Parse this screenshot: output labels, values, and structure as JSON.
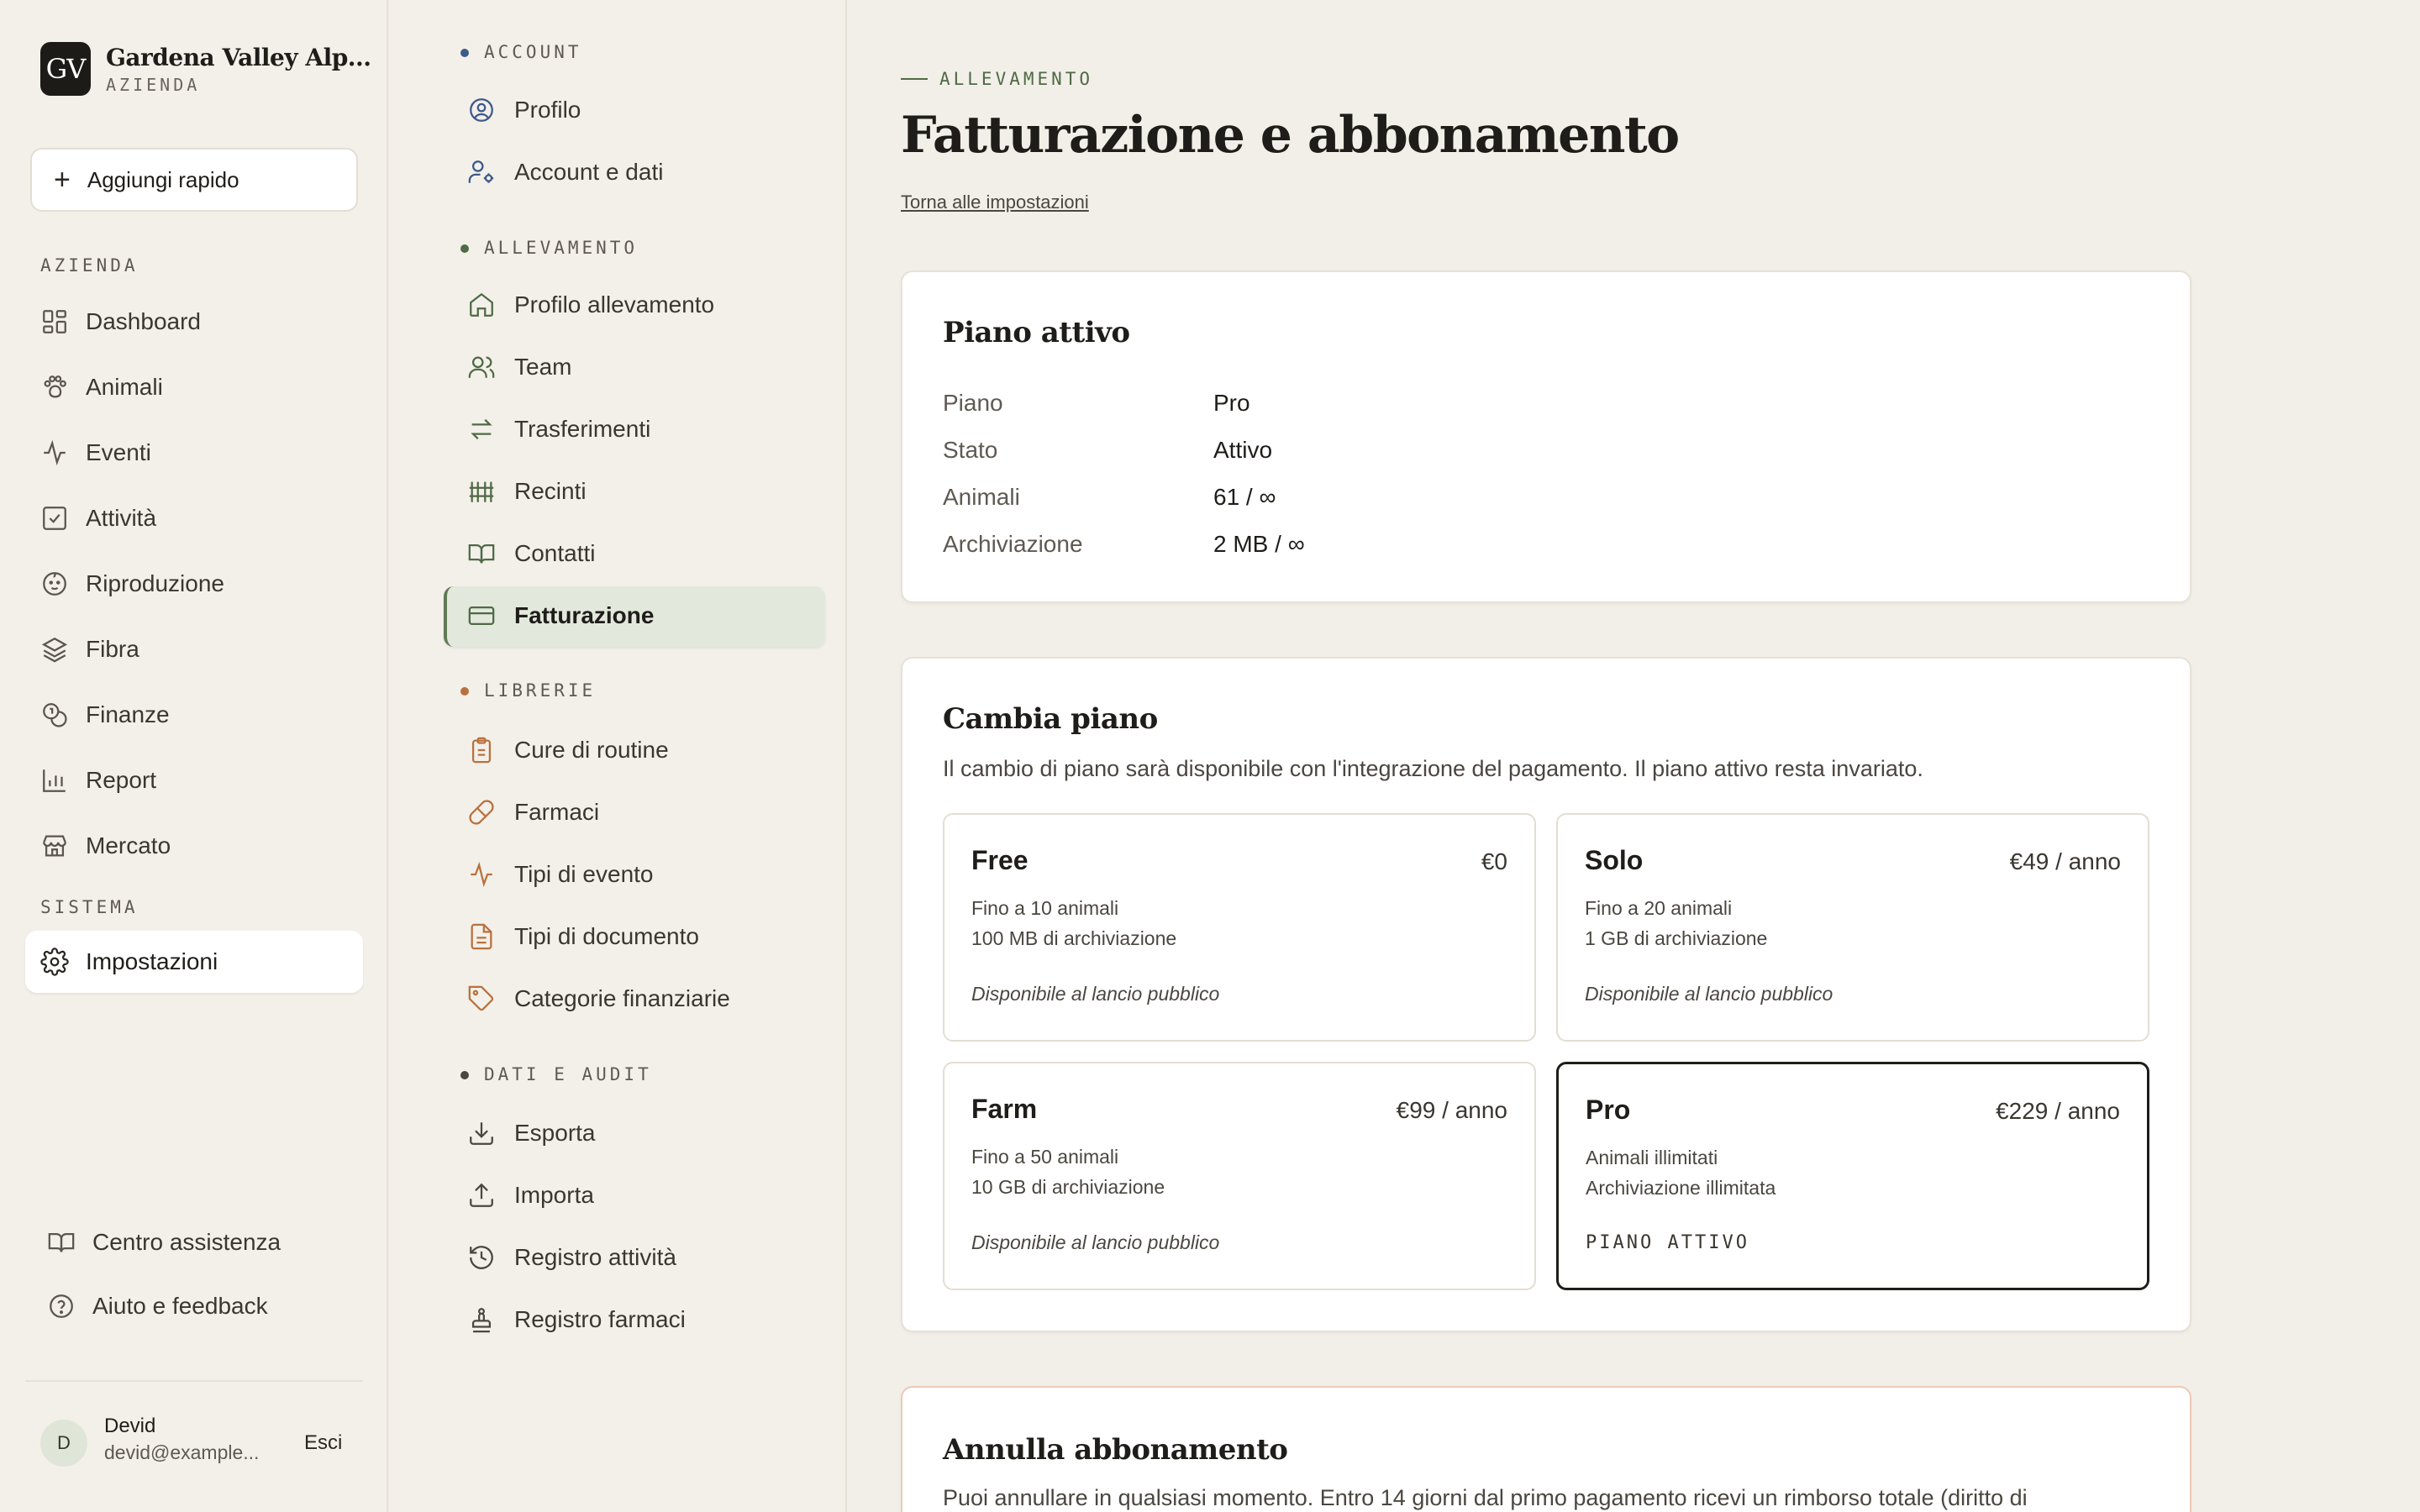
{
  "brand": {
    "initials": "GV",
    "name": "Gardena Valley Alp...",
    "subtitle": "AZIENDA"
  },
  "quick_add": {
    "label": "Aggiungi rapido"
  },
  "sidebar": {
    "section_azienda": "AZIENDA",
    "items": [
      {
        "label": "Dashboard",
        "icon": "grid-icon"
      },
      {
        "label": "Animali",
        "icon": "paw-icon"
      },
      {
        "label": "Eventi",
        "icon": "pulse-icon"
      },
      {
        "label": "Attività",
        "icon": "checkbox-icon"
      },
      {
        "label": "Riproduzione",
        "icon": "baby-icon"
      },
      {
        "label": "Fibra",
        "icon": "layers-icon"
      },
      {
        "label": "Finanze",
        "icon": "coins-icon"
      },
      {
        "label": "Report",
        "icon": "bar-chart-icon"
      },
      {
        "label": "Mercato",
        "icon": "store-icon"
      }
    ],
    "section_sistema": "SISTEMA",
    "settings": {
      "label": "Impostazioni",
      "icon": "gear-icon"
    },
    "help_center": "Centro assistenza",
    "help_feedback": "Aiuto e feedback",
    "user": {
      "initial": "D",
      "name": "Devid",
      "email": "devid@example...",
      "logout": "Esci"
    }
  },
  "subnav": {
    "sections": [
      {
        "title": "ACCOUNT",
        "dot_color": "#3e5a8a",
        "items": [
          {
            "label": "Profilo",
            "icon": "user-circle-icon"
          },
          {
            "label": "Account e dati",
            "icon": "user-cog-icon"
          }
        ]
      },
      {
        "title": "ALLEVAMENTO",
        "dot_color": "#4f6a46",
        "items": [
          {
            "label": "Profilo allevamento",
            "icon": "home-icon"
          },
          {
            "label": "Team",
            "icon": "users-icon"
          },
          {
            "label": "Trasferimenti",
            "icon": "arrows-icon"
          },
          {
            "label": "Recinti",
            "icon": "fence-icon"
          },
          {
            "label": "Contatti",
            "icon": "book-icon"
          },
          {
            "label": "Fatturazione",
            "icon": "credit-card-icon"
          }
        ]
      },
      {
        "title": "LIBRERIE",
        "dot_color": "#b8713e",
        "items": [
          {
            "label": "Cure di routine",
            "icon": "clipboard-icon"
          },
          {
            "label": "Farmaci",
            "icon": "pill-icon"
          },
          {
            "label": "Tipi di evento",
            "icon": "pulse-icon"
          },
          {
            "label": "Tipi di documento",
            "icon": "document-icon"
          },
          {
            "label": "Categorie finanziarie",
            "icon": "tag-icon"
          }
        ]
      },
      {
        "title": "DATI E AUDIT",
        "dot_color": "#4a4640",
        "items": [
          {
            "label": "Esporta",
            "icon": "download-icon"
          },
          {
            "label": "Importa",
            "icon": "upload-icon"
          },
          {
            "label": "Registro attività",
            "icon": "history-icon"
          },
          {
            "label": "Registro farmaci",
            "icon": "stamp-icon"
          }
        ]
      }
    ]
  },
  "page": {
    "eyebrow": "ALLEVAMENTO",
    "title": "Fatturazione e abbonamento",
    "back_link": "Torna alle impostazioni"
  },
  "active_plan": {
    "title": "Piano attivo",
    "rows": [
      {
        "label": "Piano",
        "value": "Pro"
      },
      {
        "label": "Stato",
        "value": "Attivo"
      },
      {
        "label": "Animali",
        "value": "61 / ∞"
      },
      {
        "label": "Archiviazione",
        "value": "2 MB / ∞"
      }
    ]
  },
  "change_plan": {
    "title": "Cambia piano",
    "description": "Il cambio di piano sarà disponibile con l'integrazione del pagamento. Il piano attivo resta invariato.",
    "plans": [
      {
        "name": "Free",
        "price": "€0",
        "f1": "Fino a 10 animali",
        "f2": "100 MB di archiviazione",
        "note": "Disponibile al lancio pubblico"
      },
      {
        "name": "Solo",
        "price": "€49 / anno",
        "f1": "Fino a 20 animali",
        "f2": "1 GB di archiviazione",
        "note": "Disponibile al lancio pubblico"
      },
      {
        "name": "Farm",
        "price": "€99 / anno",
        "f1": "Fino a 50 animali",
        "f2": "10 GB di archiviazione",
        "note": "Disponibile al lancio pubblico"
      },
      {
        "name": "Pro",
        "price": "€229 / anno",
        "f1": "Animali illimitati",
        "f2": "Archiviazione illimitata",
        "note": "PIANO ATTIVO"
      }
    ]
  },
  "cancel": {
    "title": "Annulla abbonamento",
    "description": "Puoi annullare in qualsiasi momento. Entro 14 giorni dal primo pagamento ricevi un rimborso totale (diritto di"
  }
}
